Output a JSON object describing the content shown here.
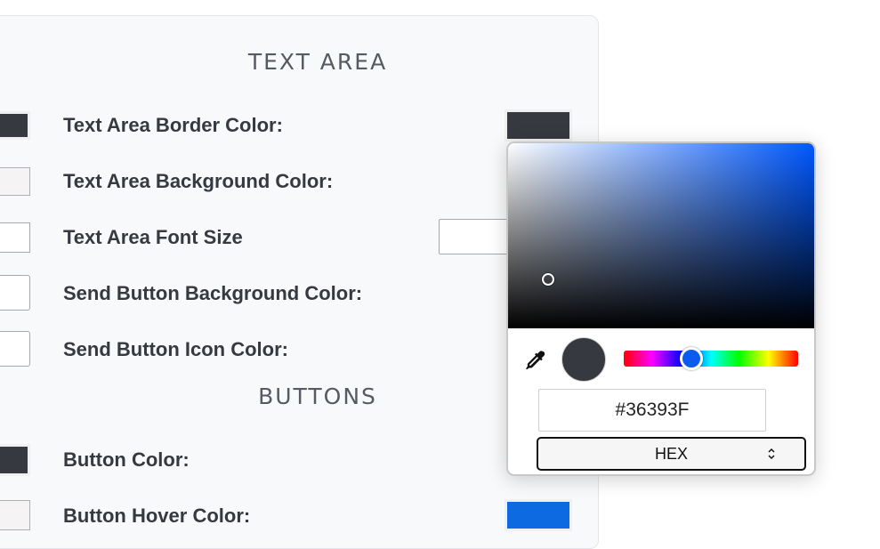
{
  "sections": {
    "text_area": {
      "title": "TEXT AREA",
      "rows": [
        {
          "label": "Text Area Border Color:",
          "swatch": "#36393f"
        },
        {
          "label": "Text Area Background Color:",
          "swatch": "#f5f3f4"
        },
        {
          "label": "Text Area Font Size",
          "swatch": "#ffffff"
        },
        {
          "label": "Send Button Background Color:",
          "swatch": "#ffffff"
        },
        {
          "label": "Send Button Icon Color:",
          "swatch": "#ffffff"
        }
      ]
    },
    "buttons": {
      "title": "BUTTONS",
      "rows": [
        {
          "label": "Button Color:",
          "swatch": "#36393f"
        },
        {
          "label": "Button Hover Color:",
          "swatch": "#f5f3f4",
          "right_swatch": "#0e6ae0"
        }
      ]
    }
  },
  "picker": {
    "hex_value": "#36393F",
    "mode": "HEX",
    "current_color": "#36393f",
    "hue_color": "#0058ff"
  },
  "icons": {
    "eyedropper": "eyedropper-icon",
    "mode_arrows": "chevron-updown-icon"
  }
}
